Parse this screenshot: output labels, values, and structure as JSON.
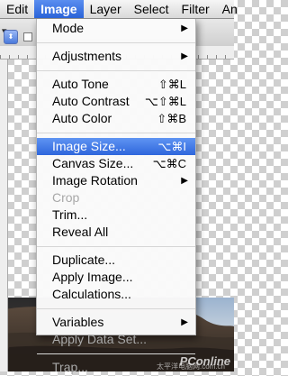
{
  "menubar": {
    "items": [
      "Edit",
      "Image",
      "Layer",
      "Select",
      "Filter",
      "An"
    ],
    "active": "Image"
  },
  "image_menu": {
    "mode": {
      "label": "Mode"
    },
    "adjustments": {
      "label": "Adjustments"
    },
    "auto_tone": {
      "label": "Auto Tone",
      "shortcut": "⇧⌘L"
    },
    "auto_contrast": {
      "label": "Auto Contrast",
      "shortcut": "⌥⇧⌘L"
    },
    "auto_color": {
      "label": "Auto Color",
      "shortcut": "⇧⌘B"
    },
    "image_size": {
      "label": "Image Size...",
      "shortcut": "⌥⌘I"
    },
    "canvas_size": {
      "label": "Canvas Size...",
      "shortcut": "⌥⌘C"
    },
    "image_rotation": {
      "label": "Image Rotation"
    },
    "crop": {
      "label": "Crop"
    },
    "trim": {
      "label": "Trim..."
    },
    "reveal_all": {
      "label": "Reveal All"
    },
    "duplicate": {
      "label": "Duplicate..."
    },
    "apply_image": {
      "label": "Apply Image..."
    },
    "calculations": {
      "label": "Calculations..."
    },
    "variables": {
      "label": "Variables"
    },
    "apply_data_set": {
      "label": "Apply Data Set..."
    },
    "trap": {
      "label": "Trap..."
    }
  },
  "submenu_arrow": "▶",
  "watermark": {
    "brand": "PConline",
    "sub": "太平洋电脑网.com.cn"
  },
  "colors": {
    "highlight": "#3a72e0",
    "disabled_text": "#a8a8a8"
  }
}
